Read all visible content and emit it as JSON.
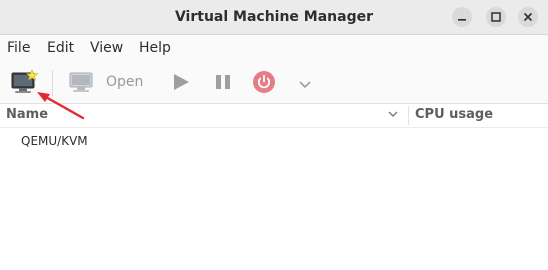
{
  "window": {
    "title": "Virtual Machine Manager"
  },
  "menu": {
    "items": [
      {
        "label": "File"
      },
      {
        "label": "Edit"
      },
      {
        "label": "View"
      },
      {
        "label": "Help"
      }
    ]
  },
  "toolbar": {
    "new_vm_icon": "new-vm-icon",
    "open_label": "Open",
    "play_icon": "play-icon",
    "pause_icon": "pause-icon",
    "power_icon": "power-icon",
    "dropdown_icon": "chevron-down-icon",
    "power_color": "#e57c86"
  },
  "list": {
    "columns": [
      {
        "label": "Name"
      },
      {
        "label": "CPU usage"
      }
    ],
    "rows": [
      {
        "label": "QEMU/KVM"
      }
    ]
  },
  "annotation": {
    "arrow_color": "#e3282f"
  }
}
